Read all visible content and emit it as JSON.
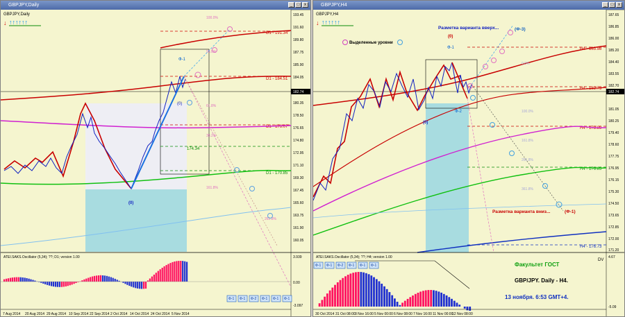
{
  "left": {
    "title": "GBPJPY,Daily",
    "symbol": "GBPJPY,Daily",
    "price_axis": [
      "193.45",
      "191.60",
      "189.80",
      "187.75",
      "185.90",
      "184.05",
      "182.20",
      "180.35",
      "178.50",
      "176.65",
      "174.80",
      "172.95",
      "171.10",
      "169.30",
      "167.45",
      "165.60",
      "163.75",
      "161.90",
      "160.05"
    ],
    "current_price": "182.74",
    "levels": {
      "d1_19134": "D1 - 191.34",
      "d1_18451": "D1 - 184.51",
      "d1_17607": "D1 - 176.07",
      "v174_34": "174.34",
      "d1_17085": "D1 - 170.85"
    },
    "fib_labels": [
      "100.0%",
      "95.0%",
      "61.8%",
      "38.2%",
      "161.8%",
      "261.8%",
      "0.0%"
    ],
    "wave_labels": {
      "phi_1": "Ф-1",
      "w0_top": "(0)",
      "w0_bottom": "(0)",
      "w_2": "Ф-2"
    },
    "osc_title": "ATEI.SAKS.Oscillator (5,34); ??; D1; version 1.00",
    "osc_scale": {
      "top": "3.939",
      "zero": "0.00",
      "bottom": "-3.097"
    },
    "buttons": [
      "Ф-1",
      "Ф-1",
      "Ф-2",
      "Ф-1",
      "Ф-1",
      "Ф-1"
    ],
    "dates": [
      "7 Aug 2014",
      "20 Aug 2014",
      "29 Aug 2014",
      "10 Sep 2014",
      "22 Sep 2014",
      "2 Oct 2014",
      "14 Oct 2014",
      "24 Oct 2014",
      "5 Nov 2014"
    ]
  },
  "right": {
    "title": "GBPJPY,H4",
    "symbol": "GBPJPY,H4",
    "price_axis": [
      "187.65",
      "186.85",
      "186.00",
      "185.20",
      "184.40",
      "183.55",
      "182.70",
      "181.90",
      "181.05",
      "180.25",
      "179.40",
      "178.60",
      "177.75",
      "176.95",
      "176.15",
      "175.30",
      "174.50",
      "173.65",
      "172.85",
      "172.00",
      "171.20"
    ],
    "current_price": "182.74",
    "legend_label": "Выделенные уровни",
    "up_variant": "Разметка варианта вверх...",
    "down_variant": "Разметка варианта вниз...",
    "phi_3": "(Ф-3)",
    "phi_1": "(Ф-1)",
    "levels": {
      "h4_18598": "H4 - 185.98",
      "h4_18273": "H4 - 182.73",
      "h4_17889": "H4 - 178.89",
      "h4_17685": "H4 - 176.85",
      "h4_17673": "H4 - 176.73"
    },
    "fib_labels": [
      "0.0%",
      "61.8%",
      "100.0%",
      "161.8%",
      "261.8%",
      "361.8%"
    ],
    "osc_title": "ATEI.SAKS.Oscillator (5,34); ??; H4; version 1.00",
    "osc_scale": {
      "top": "4.67",
      "zero": "DV",
      "bottom": "-5.09"
    },
    "buttons": [
      "Ф-1",
      "Ф-1",
      "Ф-2",
      "Ф-1",
      "Ф-1",
      "Ф-1"
    ],
    "dates": [
      "30 Oct 2014",
      "31 Oct 08:00",
      "3 Nov 16:00",
      "5 Nov 00:00",
      "6 Nov 08:00",
      "7 Nov 16:00",
      "11 Nov 00:00",
      "12 Nov 08:00"
    ],
    "overlay_line1": "Факультет ГОСТ",
    "overlay_line2": "GBP/JPY. Daily - H4.",
    "overlay_line3": "13 ноября. 6:53 GMT+4."
  }
}
